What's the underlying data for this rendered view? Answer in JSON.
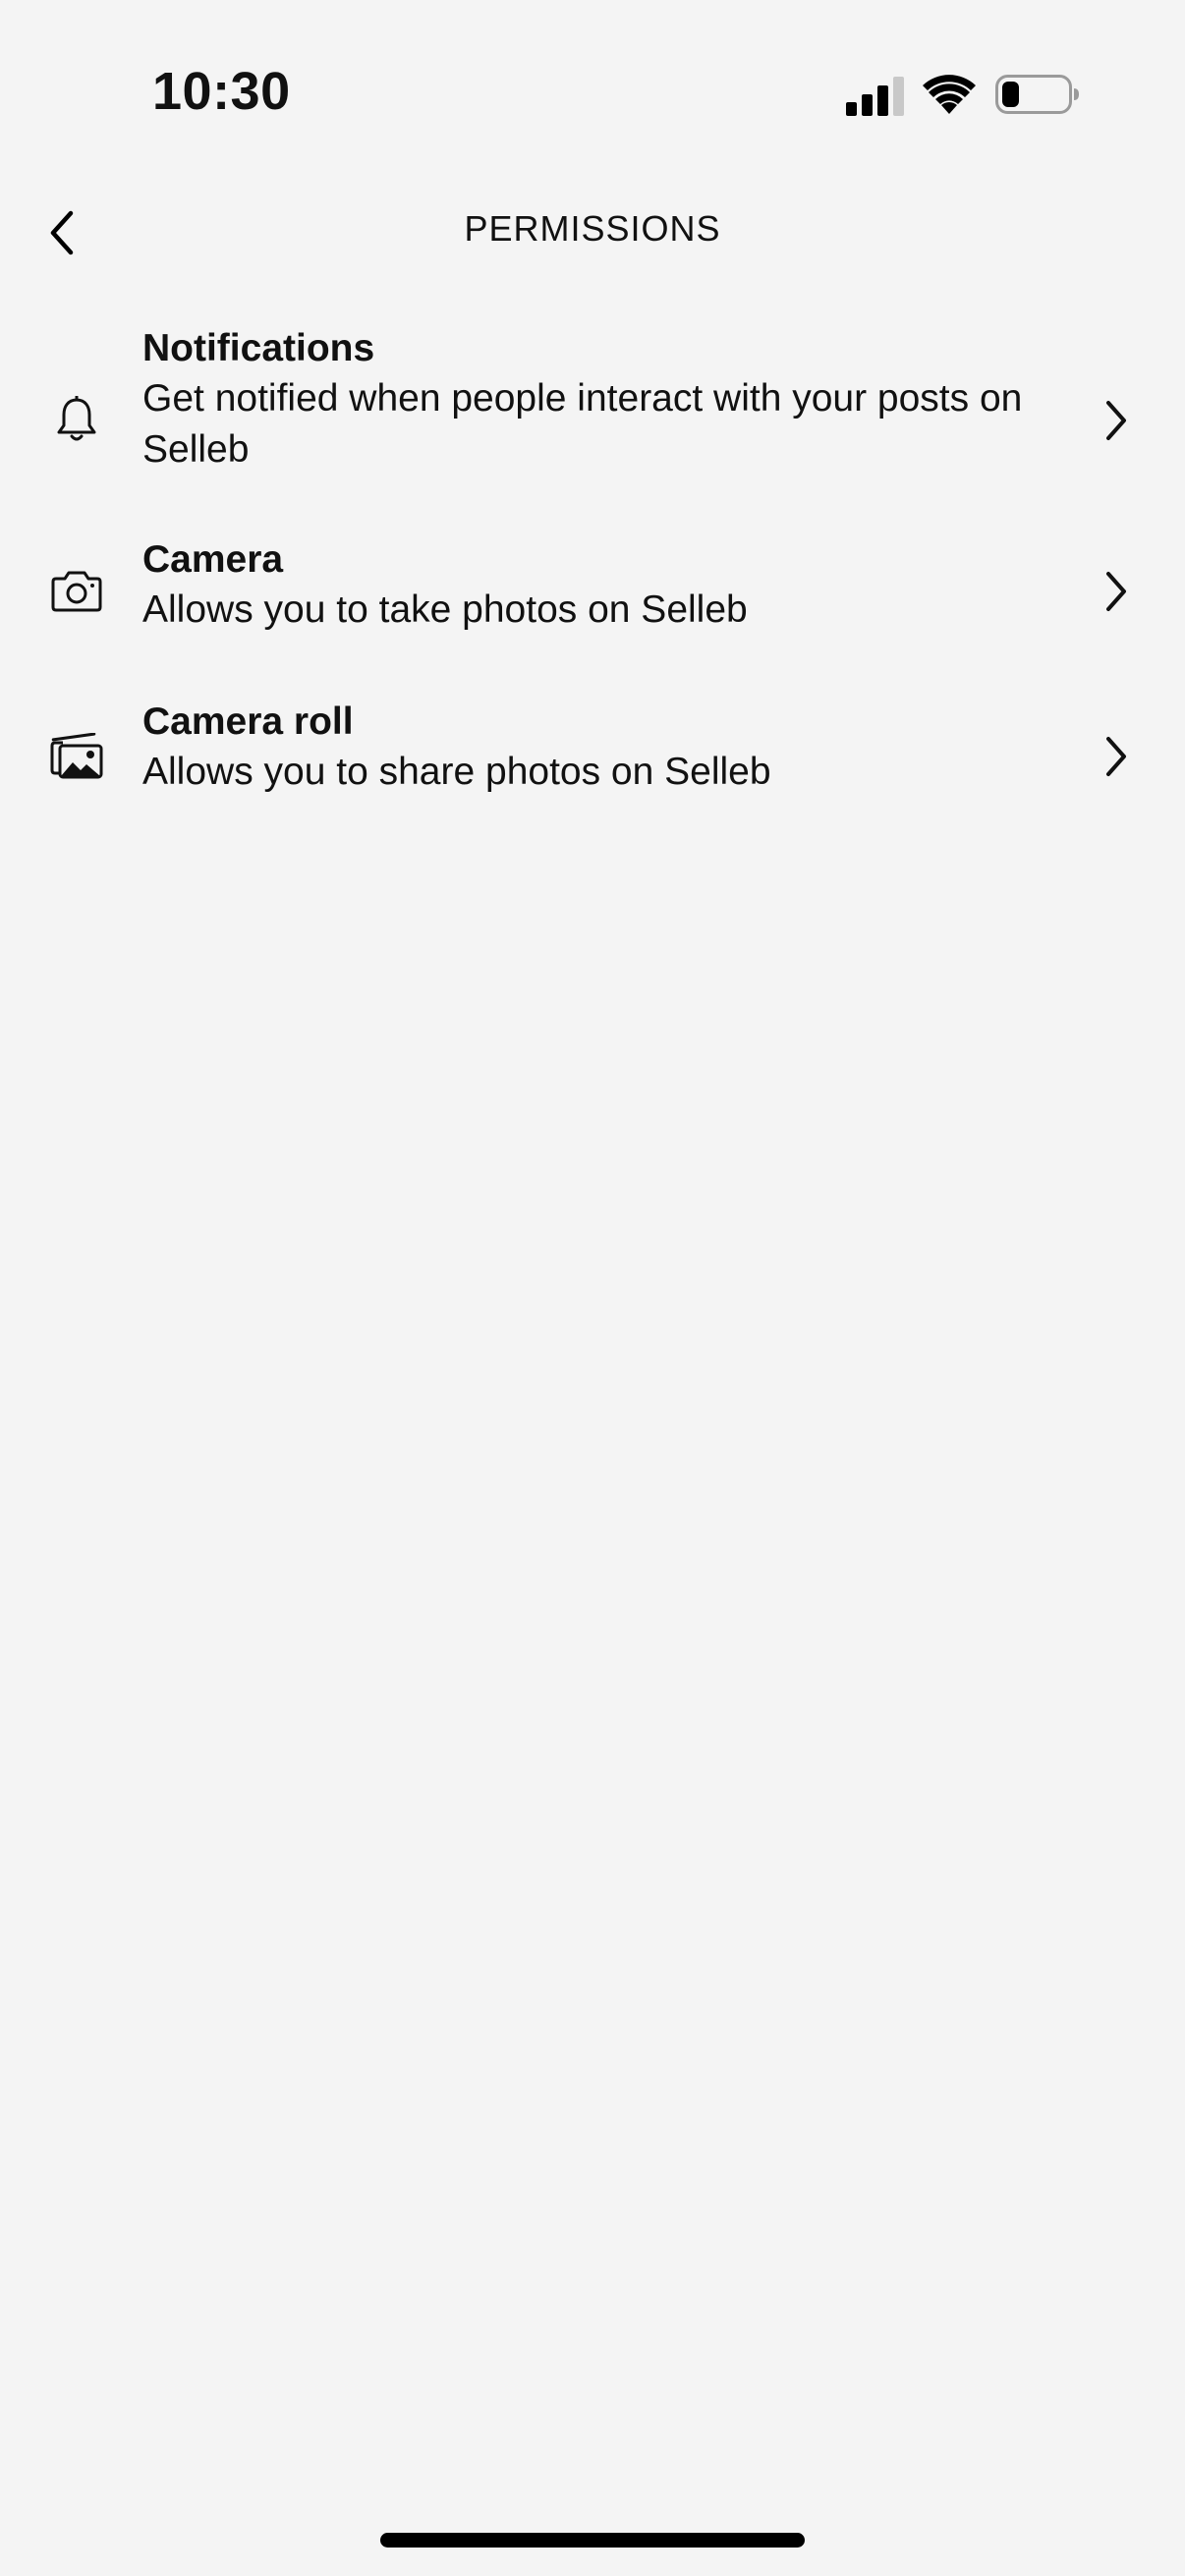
{
  "status_bar": {
    "time": "10:30",
    "icons": [
      "cellular-signal-icon",
      "wifi-icon",
      "battery-icon"
    ]
  },
  "nav": {
    "title": "PERMISSIONS",
    "back_icon": "chevron-left-icon"
  },
  "permissions": [
    {
      "icon": "bell-icon",
      "title": "Notifications",
      "description": "Get notified when people interact with your posts on Selleb"
    },
    {
      "icon": "camera-icon",
      "title": "Camera",
      "description": "Allows you to take photos on Selleb"
    },
    {
      "icon": "photo-library-icon",
      "title": "Camera roll",
      "description": "Allows you to share photos on Selleb"
    }
  ],
  "colors": {
    "background": "#f4f4f4",
    "text": "#111111"
  }
}
